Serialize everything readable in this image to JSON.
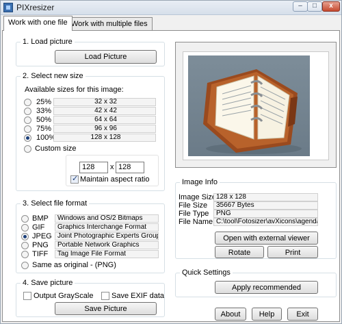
{
  "window": {
    "title": "PIXresizer",
    "min_label": "–",
    "max_label": "□",
    "close_label": "x"
  },
  "tabs": [
    {
      "label": "Work with one file"
    },
    {
      "label": "Work with multiple files"
    }
  ],
  "load": {
    "title": "1. Load picture",
    "button": "Load Picture"
  },
  "size": {
    "title": "2. Select new size",
    "available_label": "Available sizes for this image:",
    "options": [
      {
        "pct": "25%",
        "dims": "32 x 32",
        "selected": false
      },
      {
        "pct": "33%",
        "dims": "42 x 42",
        "selected": false
      },
      {
        "pct": "50%",
        "dims": "64 x 64",
        "selected": false
      },
      {
        "pct": "75%",
        "dims": "96 x 96",
        "selected": false
      },
      {
        "pct": "100%",
        "dims": "128 x 128",
        "selected": true
      }
    ],
    "custom_label": "Custom size",
    "width_value": "128",
    "x_label": "x",
    "height_value": "128",
    "aspect_label": "Maintain aspect ratio",
    "aspect_checked": true
  },
  "format": {
    "title": "3. Select file format",
    "options": [
      {
        "name": "BMP",
        "desc": "Windows and OS/2 Bitmaps",
        "selected": false
      },
      {
        "name": "GIF",
        "desc": "Graphics Interchange Format",
        "selected": false
      },
      {
        "name": "JPEG",
        "desc": "Joint Photographic Experts Group",
        "selected": true
      },
      {
        "name": "PNG",
        "desc": "Portable Network Graphics",
        "selected": false
      },
      {
        "name": "TIFF",
        "desc": "Tag Image File Format",
        "selected": false
      }
    ],
    "same_label": "Same as original  - (PNG)"
  },
  "save": {
    "title": "4. Save picture",
    "grayscale_label": "Output GrayScale",
    "grayscale_checked": false,
    "exif_label": "Save EXIF data",
    "exif_checked": false,
    "button": "Save Picture"
  },
  "info": {
    "title": "Image Info",
    "rows": [
      {
        "label": "Image Size",
        "value": "128 x 128"
      },
      {
        "label": "File Size",
        "value": "35667 Bytes"
      },
      {
        "label": "File Type",
        "value": "PNG"
      },
      {
        "label": "File Name",
        "value": "C:\\tool\\Fotosizer\\avXicons\\agenda."
      }
    ],
    "open_button": "Open with external viewer",
    "rotate_button": "Rotate",
    "print_button": "Print"
  },
  "quick": {
    "title": "Quick Settings",
    "apply_button": "Apply recommended"
  },
  "footer": {
    "about": "About",
    "help": "Help",
    "exit": "Exit"
  },
  "preview": {
    "icon": "agenda-planner-icon"
  }
}
